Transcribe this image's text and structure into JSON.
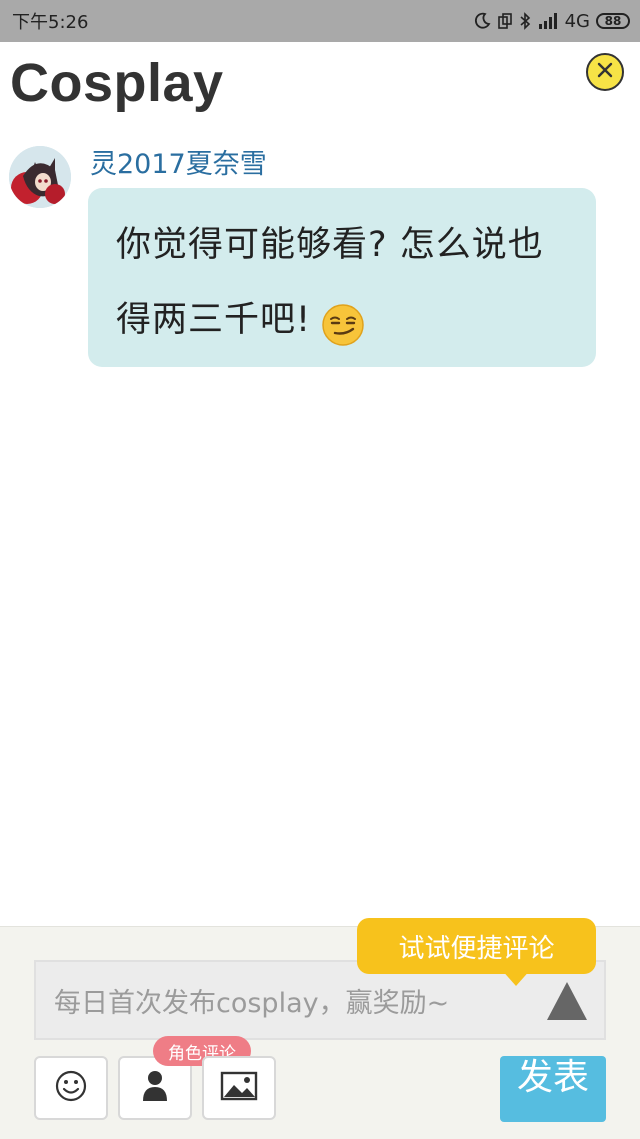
{
  "status_bar": {
    "time": "下午5:26",
    "network": "4G",
    "battery": "88",
    "icons": [
      "moon-icon",
      "screen-rotate-icon",
      "bluetooth-icon",
      "signal-icon"
    ]
  },
  "header": {
    "title": "Cosplay",
    "close_icon": "close-icon"
  },
  "message": {
    "username": "灵2017夏奈雪",
    "text": "你觉得可能够看? 怎么说也得两三千吧!",
    "emoji": "smirk-face"
  },
  "composer": {
    "placeholder": "每日首次发布cosplay，赢奖励~",
    "tip": "试试便捷评论",
    "role_badge": "角色评论",
    "publish_label": "发表",
    "tools": [
      "smiley-icon",
      "person-icon",
      "image-icon"
    ]
  },
  "colors": {
    "bubble": "#d3eced",
    "username": "#2a6ea0",
    "tip": "#f7c21c",
    "publish": "#56bde0",
    "badge": "#ef7d86",
    "close": "#f7e346"
  }
}
